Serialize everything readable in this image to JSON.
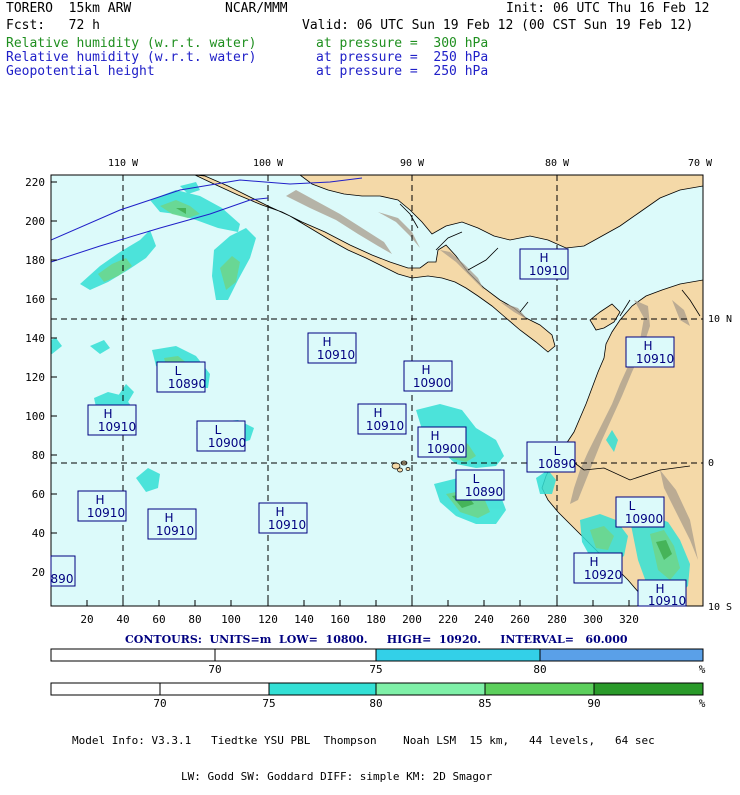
{
  "header": {
    "left_line1": "TORERO  15km ARW",
    "center_line1": "NCAR/MMM",
    "right_line1": "Init: 06 UTC Thu 16 Feb 12",
    "left_line2": "Fcst:   72 h",
    "right_line2": "Valid: 06 UTC Sun 19 Feb 12 (00 CST Sun 19 Feb 12)",
    "fields": [
      {
        "name": "Relative humidity (w.r.t. water)",
        "level": "at pressure =  300 hPa",
        "color": "#1f8f1f"
      },
      {
        "name": "Relative humidity (w.r.t. water)",
        "level": "at pressure =  250 hPa",
        "color": "#2020c8"
      },
      {
        "name": "Geopotential height",
        "level": "at pressure =  250 hPa",
        "color": "#2020c8"
      }
    ]
  },
  "map": {
    "top_labels": [
      "110 W",
      "100 W",
      "90 W",
      "80 W",
      "70 W"
    ],
    "left_labels": [
      "220",
      "200",
      "180",
      "160",
      "140",
      "120",
      "100",
      "80",
      "60",
      "40",
      "20"
    ],
    "bottom_labels": [
      "20",
      "40",
      "60",
      "80",
      "100",
      "120",
      "140",
      "160",
      "180",
      "200",
      "220",
      "240",
      "260",
      "280",
      "300",
      "320"
    ],
    "right_labels": [
      "10 N",
      "0",
      "10 S"
    ],
    "colors": {
      "ocean": "#dcfafa",
      "land": "#f4d9a8",
      "terrain": "#a89c8c",
      "rh_cyan": "#33e0d5",
      "rh_green": "#6dd68d"
    },
    "centers": [
      {
        "type": "H",
        "value": "10910"
      },
      {
        "type": "H",
        "value": "10910"
      },
      {
        "type": "L",
        "value": "10890"
      },
      {
        "type": "H",
        "value": "10900"
      },
      {
        "type": "H",
        "value": "10910"
      },
      {
        "type": "H",
        "value": "10910"
      },
      {
        "type": "L",
        "value": "10900"
      },
      {
        "type": "H",
        "value": "10910"
      },
      {
        "type": "H",
        "value": "10900"
      },
      {
        "type": "L",
        "value": "10890"
      },
      {
        "type": "L",
        "value": "10890"
      },
      {
        "type": "H",
        "value": "10910"
      },
      {
        "type": "H",
        "value": "10910"
      },
      {
        "type": "H",
        "value": "10910"
      },
      {
        "type": "L",
        "value": "10900"
      },
      {
        "type": "H",
        "value": "10920"
      },
      {
        "type": "H",
        "value": "10910"
      },
      {
        "type": "",
        "value": "890"
      }
    ]
  },
  "contours": "CONTOURS:  UNITS=m  LOW=  10800.     HIGH=  10920.     INTERVAL=   60.000",
  "colorbar1": {
    "labels": [
      "70",
      "75",
      "80"
    ],
    "unit": "%",
    "colors": [
      "#ffffff",
      "#ffffff",
      "#33d0e8",
      "#5aa0e8"
    ]
  },
  "colorbar2": {
    "labels": [
      "70",
      "75",
      "80",
      "85",
      "90"
    ],
    "unit": "%",
    "colors": [
      "#ffffff",
      "#ffffff",
      "#33e0d5",
      "#7ff0a8",
      "#5ccf5c",
      "#2a9a2a"
    ]
  },
  "model_info": {
    "line1": "Model Info: V3.3.1   Tiedtke YSU PBL  Thompson    Noah LSM  15 km,   44 levels,   64 sec",
    "line2": "LW: Godd SW: Goddard DIFF: simple KM: 2D Smagor"
  }
}
